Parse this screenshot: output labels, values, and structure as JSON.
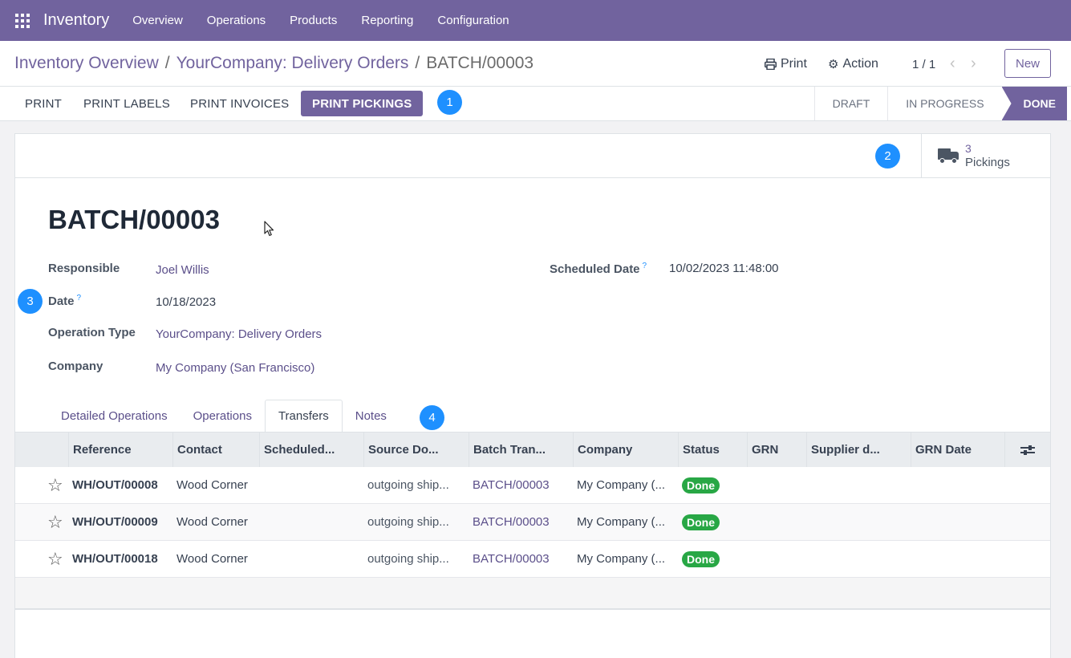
{
  "navbar": {
    "brand": "Inventory",
    "items": [
      "Overview",
      "Operations",
      "Products",
      "Reporting",
      "Configuration"
    ]
  },
  "breadcrumb": {
    "items": [
      "Inventory Overview",
      "YourCompany: Delivery Orders"
    ],
    "separator": "/",
    "current": "BATCH/00003"
  },
  "control": {
    "print": "Print",
    "action": "Action",
    "pager": "1 / 1",
    "new": "New"
  },
  "buttons": [
    "PRINT",
    "PRINT LABELS",
    "PRINT INVOICES",
    "PRINT PICKINGS"
  ],
  "status_stages": [
    "DRAFT",
    "IN PROGRESS",
    "DONE"
  ],
  "annotations": [
    "1",
    "2",
    "3",
    "4"
  ],
  "smart_button": {
    "value": "3",
    "label": "Pickings"
  },
  "record": {
    "title": "BATCH/00003",
    "fields": {
      "responsible": {
        "label": "Responsible",
        "value": "Joel Willis"
      },
      "date": {
        "label": "Date",
        "value": "10/18/2023"
      },
      "operation_type": {
        "label": "Operation Type",
        "value": "YourCompany: Delivery Orders"
      },
      "company": {
        "label": "Company",
        "value": "My Company (San Francisco)"
      },
      "scheduled_date": {
        "label": "Scheduled Date",
        "value": "10/02/2023 11:48:00"
      }
    },
    "help_mark": "?"
  },
  "tabs": [
    "Detailed Operations",
    "Operations",
    "Transfers",
    "Notes"
  ],
  "table": {
    "columns": [
      "Reference",
      "Contact",
      "Scheduled...",
      "Source Do...",
      "Batch Tran...",
      "Company",
      "Status",
      "GRN",
      "Supplier d...",
      "GRN Date"
    ],
    "rows": [
      {
        "reference": "WH/OUT/00008",
        "contact": "Wood Corner",
        "scheduled": "",
        "source": "outgoing ship...",
        "batch": "BATCH/00003",
        "company": "My Company (...",
        "status": "Done"
      },
      {
        "reference": "WH/OUT/00009",
        "contact": "Wood Corner",
        "scheduled": "",
        "source": "outgoing ship...",
        "batch": "BATCH/00003",
        "company": "My Company (...",
        "status": "Done"
      },
      {
        "reference": "WH/OUT/00018",
        "contact": "Wood Corner",
        "scheduled": "",
        "source": "outgoing ship...",
        "batch": "BATCH/00003",
        "company": "My Company (...",
        "status": "Done"
      }
    ]
  },
  "colors": {
    "brand": "#71639e",
    "done": "#28a745",
    "annotation": "#1e90ff"
  }
}
